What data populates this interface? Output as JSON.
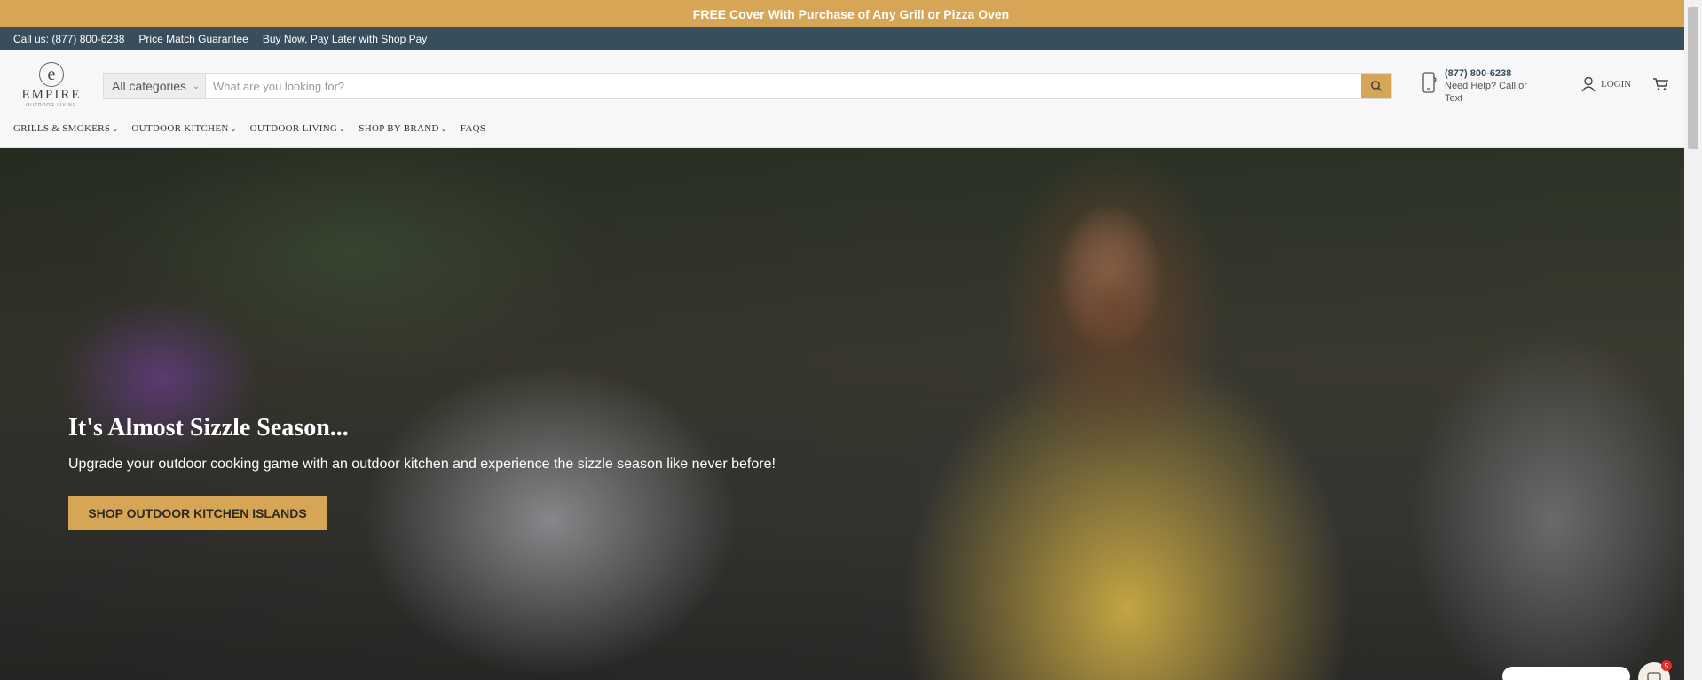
{
  "promo": {
    "text": "FREE Cover With Purchase of Any Grill or Pizza Oven"
  },
  "utility": {
    "items": [
      "Call us: (877) 800-6238",
      "Price Match Guarantee",
      "Buy Now, Pay Later with Shop Pay"
    ]
  },
  "logo": {
    "mark": "e",
    "word": "EMPIRE",
    "sub": "OUTDOOR LIVING"
  },
  "search": {
    "category": "All categories",
    "placeholder": "What are you looking for?",
    "button_icon": "search-icon"
  },
  "help": {
    "phone": "(877) 800-6238",
    "text": "Need Help? Call or Text",
    "icon": "phone-icon"
  },
  "account": {
    "login_label": "LOGIN",
    "icon": "user-icon"
  },
  "cart": {
    "icon": "cart-icon"
  },
  "nav": {
    "items": [
      {
        "label": "GRILLS & SMOKERS",
        "has_dropdown": true
      },
      {
        "label": "OUTDOOR KITCHEN",
        "has_dropdown": true
      },
      {
        "label": "OUTDOOR LIVING",
        "has_dropdown": true
      },
      {
        "label": "SHOP BY BRAND",
        "has_dropdown": true
      },
      {
        "label": "FAQS",
        "has_dropdown": false
      }
    ]
  },
  "hero": {
    "title": "It's Almost Sizzle Season...",
    "subtitle": "Upgrade your outdoor cooking game with an outdoor kitchen and experience the sizzle season like never before!",
    "cta": "SHOP OUTDOOR KITCHEN ISLANDS"
  },
  "chat": {
    "badge_count": "5"
  },
  "colors": {
    "accent": "#d6a656",
    "utility_bar": "#384e5c"
  }
}
